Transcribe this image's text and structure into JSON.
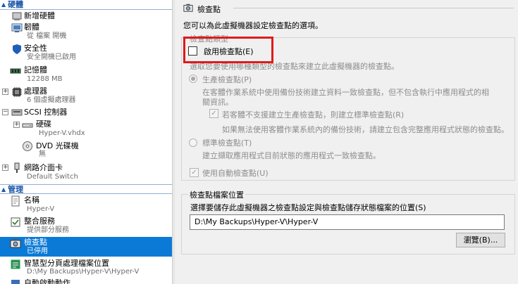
{
  "tree": {
    "hardware_header": "硬體",
    "management_header": "管理",
    "items": [
      {
        "title": "新增硬體",
        "sub": ""
      },
      {
        "title": "韌體",
        "sub": "從 檔案 開機"
      },
      {
        "title": "安全性",
        "sub": "安全開機已啟用"
      },
      {
        "title": "記憶體",
        "sub": "12288 MB"
      },
      {
        "title": "處理器",
        "sub": "6 個虛擬處理器"
      },
      {
        "title": "SCSI 控制器",
        "sub": ""
      },
      {
        "title": "硬碟",
        "sub": "Hyper-V.vhdx"
      },
      {
        "title": "DVD 光碟機",
        "sub": "無"
      },
      {
        "title": "網路介面卡",
        "sub": "Default Switch"
      },
      {
        "title": "名稱",
        "sub": "Hyper-V"
      },
      {
        "title": "整合服務",
        "sub": "提供部分服務"
      },
      {
        "title": "檢查點",
        "sub": "已停用"
      },
      {
        "title": "智慧型分頁處理檔案位置",
        "sub": "D:\\My Backups\\Hyper-V\\Hyper-V"
      },
      {
        "title": "自動啟動動作",
        "sub": ""
      }
    ]
  },
  "details": {
    "section_title": "檢查點",
    "description": "您可以為此虛擬機器設定檢查點的選項。",
    "type_group_label": "檢查點類型",
    "enable_label": "啟用檢查點(E)",
    "enable_checked": false,
    "type_prompt": "選取您要使用哪種類型的檢查點來建立此虛擬機器的檢查點。",
    "production_label": "生產檢查點(P)",
    "production_desc_1": "在客體作業系統中使用備份技術建立資料一致檢查點，但不包含執行中應用程式的相",
    "production_desc_2": "關資訊。",
    "fallback_label": "若客體不支援建立生產檢查點，則建立標準檢查點(R)",
    "fallback_desc": "如果無法使用客體作業系統內的備份技術，請建立包含完整應用程式狀態的檢查點。",
    "standard_label": "標準檢查點(T)",
    "standard_desc": "建立擷取應用程式目前狀態的應用程式一致檢查點。",
    "auto_label": "使用自動檢查點(U)",
    "location_group_label": "檢查點檔案位置",
    "location_prompt": "選擇要儲存此虛擬機器之檢查點設定與檢查點儲存狀態檔案的位置(S)",
    "location_value": "D:\\My Backups\\Hyper-V\\Hyper-V",
    "browse_label": "瀏覽(B)..."
  },
  "colors": {
    "selection": "#0b7ad6",
    "header_text": "#1a55a8",
    "highlight_box": "#e01a1a"
  }
}
